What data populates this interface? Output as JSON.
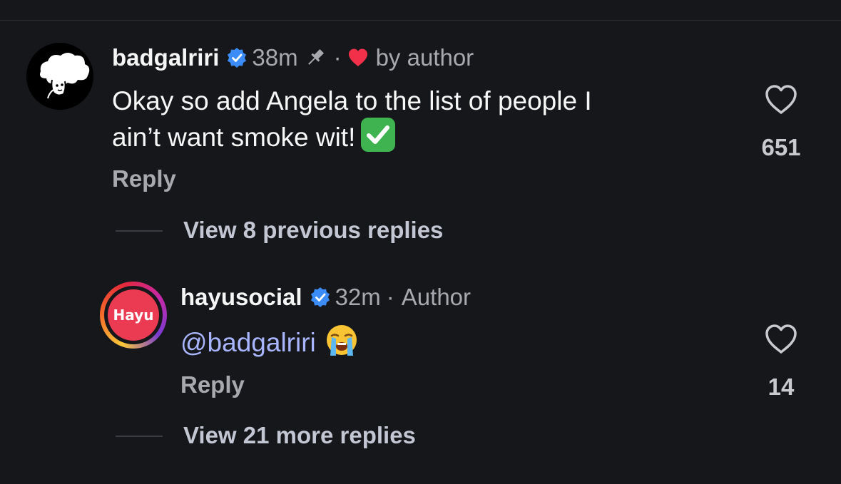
{
  "comment1": {
    "username": "badgalriri",
    "time": "38m",
    "separator": "·",
    "liked_by": "by author",
    "text_line1": "Okay so add Angela to the list of people I",
    "text_line2": "ain’t want smoke wit!",
    "emoji": "check-mark-button",
    "reply_label": "Reply",
    "likes": "651"
  },
  "view_previous": "View 8 previous replies",
  "comment2": {
    "username": "hayusocial",
    "time": "32m",
    "separator": "·",
    "author_badge": "Author",
    "avatar_text": "Hayu",
    "mention": "@badgalriri",
    "emoji": "loudly-crying-face",
    "reply_label": "Reply",
    "likes": "14"
  },
  "view_more": "View 21 more replies",
  "colors": {
    "background": "#16171b",
    "verified_blue": "#3b8cf6",
    "heart_red": "#f2304a",
    "mention": "#a9b6ff",
    "hayu_brand": "#ea3b53"
  }
}
